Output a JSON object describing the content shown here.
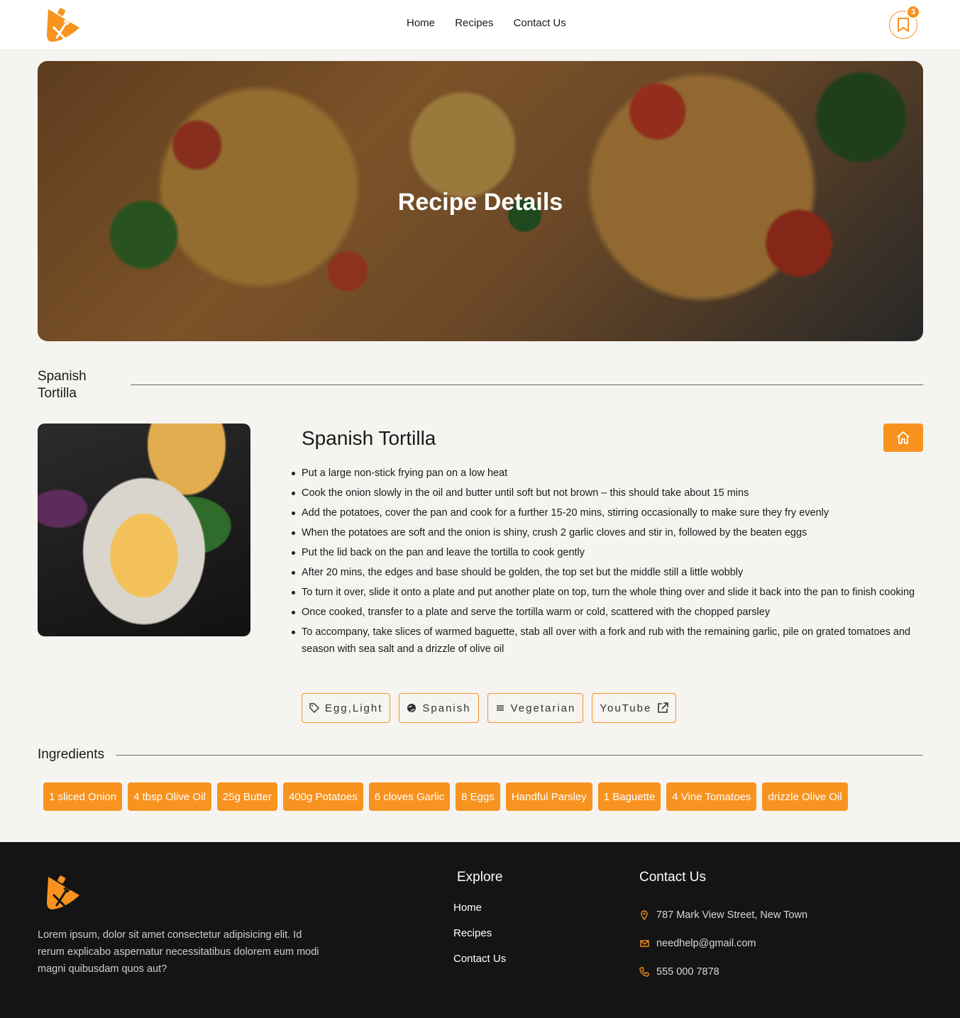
{
  "header": {
    "nav": [
      "Home",
      "Recipes",
      "Contact Us"
    ],
    "bookmark_count": "3"
  },
  "hero": {
    "title": "Recipe Details"
  },
  "recipe": {
    "section_title": "Spanish Tortilla",
    "name": "Spanish Tortilla",
    "steps": [
      "Put a large non-stick frying pan on a low heat",
      "Cook the onion slowly in the oil and butter until soft but not brown – this should take about 15 mins",
      "Add the potatoes, cover the pan and cook for a further 15-20 mins, stirring occasionally to make sure they fry evenly",
      "When the potatoes are soft and the onion is shiny, crush 2 garlic cloves and stir in, followed by the beaten eggs",
      "Put the lid back on the pan and leave the tortilla to cook gently",
      "After 20 mins, the edges and base should be golden, the top set but the middle still a little wobbly",
      "To turn it over, slide it onto a plate and put another plate on top, turn the whole thing over and slide it back into the pan to finish cooking",
      "Once cooked, transfer to a plate and serve the tortilla warm or cold, scattered with the chopped parsley",
      "To accompany, take slices of warmed baguette, stab all over with a fork and rub with the remaining garlic, pile on grated tomatoes and season with sea salt and a drizzle of olive oil"
    ],
    "tags": {
      "tag": "Egg,Light",
      "area": "Spanish",
      "category": "Vegetarian",
      "video": "YouTube"
    }
  },
  "ingredients": {
    "title": "Ingredients",
    "items": [
      "1 sliced Onion",
      "4 tbsp Olive Oil",
      "25g Butter",
      "400g Potatoes",
      "6 cloves Garlic",
      "8 Eggs",
      "Handful Parsley",
      "1 Baguette",
      "4 Vine Tomatoes",
      "drizzle Olive Oil"
    ]
  },
  "footer": {
    "about": "Lorem ipsum, dolor sit amet consectetur adipisicing elit. Id rerum explicabo aspernatur necessitatibus dolorem eum modi magni quibusdam quos aut?",
    "explore_title": "Explore",
    "explore_links": [
      "Home",
      "Recipes",
      "Contact Us"
    ],
    "contact_title": "Contact Us",
    "address": "787 Mark View Street, New Town",
    "email": "needhelp@gmail.com",
    "phone": "555 000 7878"
  },
  "colors": {
    "accent": "#f7931e",
    "footer_bg": "#141414",
    "page_bg": "#f6f4f1"
  },
  "icons": [
    "logo-icon",
    "bookmark-icon",
    "home-icon",
    "tag-icon",
    "globe-icon",
    "list-icon",
    "external-link-icon",
    "location-icon",
    "mail-icon",
    "phone-icon"
  ]
}
